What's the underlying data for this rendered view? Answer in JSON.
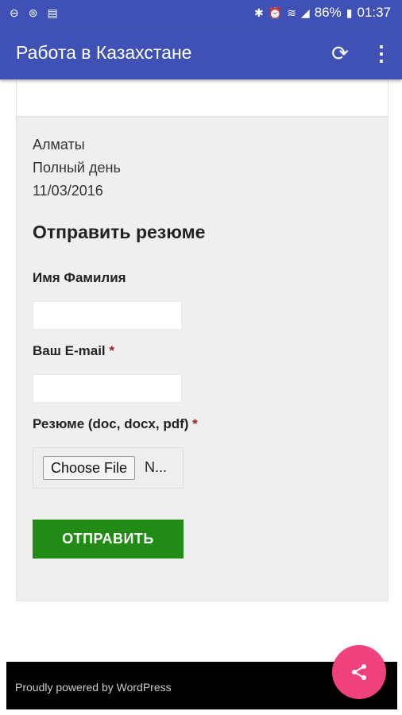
{
  "status_bar": {
    "battery": "86%",
    "time": "01:37",
    "icons": [
      "minus-circle-icon",
      "sync-circle-icon",
      "inbox-icon",
      "bluetooth-icon",
      "alarm-icon",
      "wifi-icon",
      "signal-icon",
      "battery-icon"
    ]
  },
  "app_bar": {
    "title": "Работа в Казахстане",
    "refresh_icon": "refresh-icon",
    "menu_icon": "more-vert-icon"
  },
  "job": {
    "city": "Алматы",
    "schedule": "Полный день",
    "date": "11/03/2016"
  },
  "form": {
    "title": "Отправить резюме",
    "name_label": "Имя Фамилия",
    "email_label": "Ваш E-mail",
    "required_mark": "*",
    "resume_label": "Резюме (doc, docx, pdf)",
    "choose_file_label": "Choose File",
    "no_file_text": "N...",
    "submit_label": "ОТПРАВИТЬ"
  },
  "footer": {
    "text": "Proudly powered by WordPress"
  },
  "fab": {
    "icon": "share-icon",
    "color": "#f0427a"
  },
  "colors": {
    "primary": "#3f51b5",
    "submit": "#228b15"
  }
}
